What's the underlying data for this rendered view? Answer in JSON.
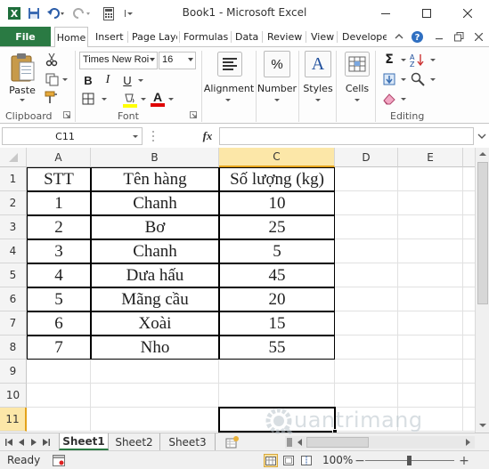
{
  "window": {
    "title": "Book1 - Microsoft Excel",
    "minimize_label": "—",
    "maximize_label": "☐",
    "close_label": "✕"
  },
  "tabs": [
    {
      "label": "File"
    },
    {
      "label": "Home"
    },
    {
      "label": "Insert"
    },
    {
      "label": "Page Layo"
    },
    {
      "label": "Formulas"
    },
    {
      "label": "Data"
    },
    {
      "label": "Review"
    },
    {
      "label": "View"
    },
    {
      "label": "Develope"
    }
  ],
  "ribbon": {
    "clipboard": {
      "paste_label": "Paste",
      "group_label": "Clipboard"
    },
    "font": {
      "font_name": "Times New Roi",
      "font_size": "16",
      "bold": "B",
      "italic": "I",
      "underline": "U",
      "font_color_letter": "A",
      "group_label": "Font"
    },
    "alignment": {
      "label": "Alignment"
    },
    "number": {
      "label": "Number",
      "glyph": "%"
    },
    "styles": {
      "label": "Styles",
      "glyph": "A"
    },
    "cells": {
      "label": "Cells"
    },
    "editing": {
      "sum_glyph": "Σ",
      "group_label": "Editing"
    }
  },
  "formula_bar": {
    "name_box": "C11",
    "fx_label": "fx",
    "value": ""
  },
  "grid": {
    "columns": [
      "A",
      "B",
      "C",
      "D",
      "E"
    ],
    "selected_column": "C",
    "rows": [
      "1",
      "2",
      "3",
      "4",
      "5",
      "6",
      "7",
      "8",
      "9",
      "10",
      "11"
    ],
    "selected_row": "11",
    "table": {
      "headers": [
        "STT",
        "Tên hàng",
        "Số lượng (kg)"
      ],
      "data": [
        [
          "1",
          "Chanh",
          "10"
        ],
        [
          "2",
          "Bơ",
          "25"
        ],
        [
          "3",
          "Chanh",
          "5"
        ],
        [
          "4",
          "Dưa hấu",
          "45"
        ],
        [
          "5",
          "Mãng cầu",
          "20"
        ],
        [
          "6",
          "Xoài",
          "15"
        ],
        [
          "7",
          "Nho",
          "55"
        ]
      ]
    },
    "active_cell": "C11"
  },
  "sheets": [
    {
      "label": "Sheet1",
      "active": true
    },
    {
      "label": "Sheet2",
      "active": false
    },
    {
      "label": "Sheet3",
      "active": false
    }
  ],
  "status": {
    "ready": "Ready",
    "zoom": "100%",
    "zoom_minus": "−",
    "zoom_plus": "+"
  },
  "watermark": {
    "text": "uantrimang"
  },
  "colors": {
    "file_tab": "#2a7a43",
    "selected_header": "#fce7a8",
    "selected_header_border": "#e3a21a"
  }
}
